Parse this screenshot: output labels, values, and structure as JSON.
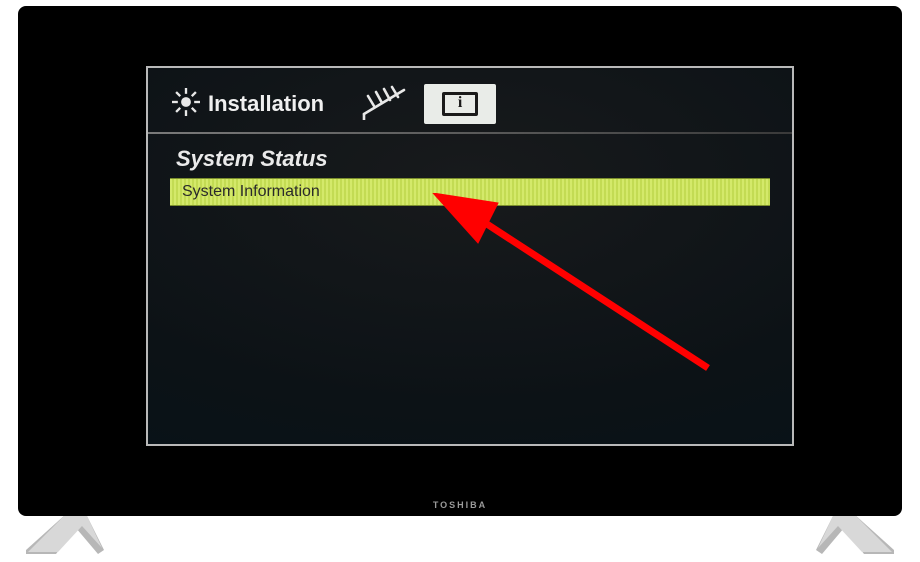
{
  "tv": {
    "brand": "TOSHIBA"
  },
  "tabs": {
    "installation": {
      "label": "Installation",
      "icon": "gear-icon"
    },
    "antenna": {
      "icon": "antenna-icon"
    },
    "info": {
      "icon": "info-icon",
      "selected": true
    }
  },
  "page": {
    "heading": "System Status",
    "items": [
      {
        "label": "System Information",
        "selected": true
      }
    ]
  },
  "annotation": {
    "arrow_color": "#ff0000"
  },
  "colors": {
    "highlight": "#d4e96a",
    "frame_border": "#b9b9b9"
  }
}
